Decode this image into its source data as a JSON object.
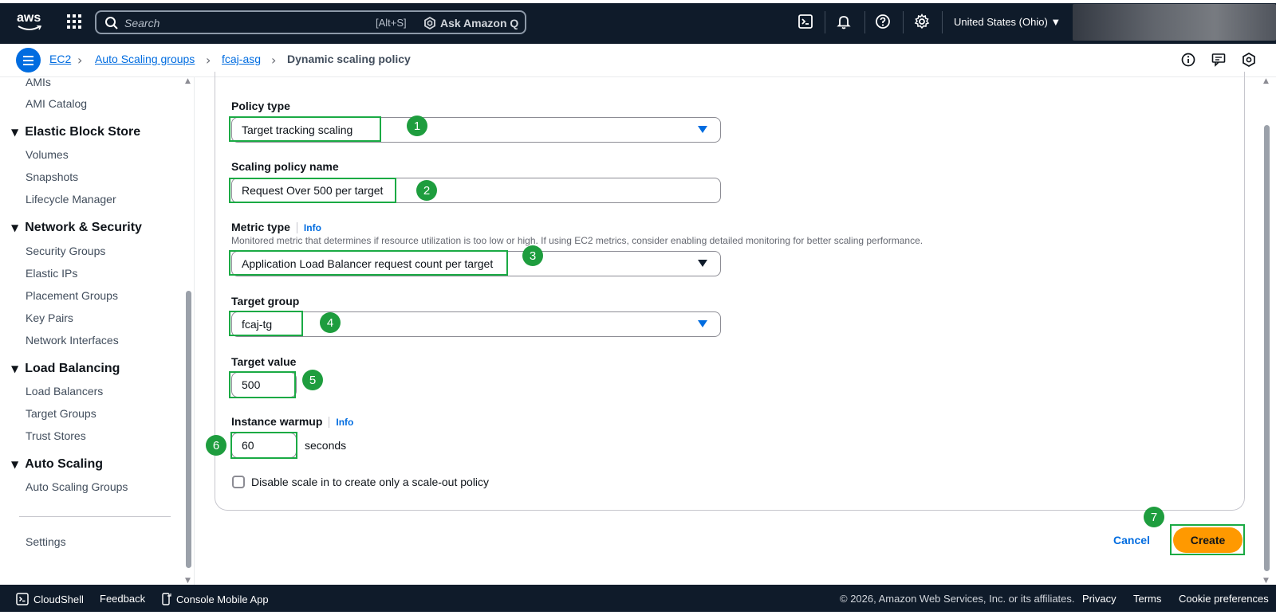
{
  "nav": {
    "logo_text": "aws",
    "search_placeholder": "Search",
    "search_shortcut": "[Alt+S]",
    "ask_q": "Ask Amazon Q",
    "region": "United States (Ohio) ▼",
    "icons": [
      "cloudshell-icon",
      "bell-icon",
      "help-icon",
      "gear-icon"
    ]
  },
  "breadcrumb": {
    "items": [
      "EC2",
      "Auto Scaling groups",
      "fcaj-asg"
    ],
    "current": "Dynamic scaling policy"
  },
  "sidebar": {
    "items_top": [
      "AMIs",
      "AMI Catalog"
    ],
    "sections": [
      {
        "title": "Elastic Block Store",
        "items": [
          "Volumes",
          "Snapshots",
          "Lifecycle Manager"
        ]
      },
      {
        "title": "Network & Security",
        "items": [
          "Security Groups",
          "Elastic IPs",
          "Placement Groups",
          "Key Pairs",
          "Network Interfaces"
        ]
      },
      {
        "title": "Load Balancing",
        "items": [
          "Load Balancers",
          "Target Groups",
          "Trust Stores"
        ]
      },
      {
        "title": "Auto Scaling",
        "items": [
          "Auto Scaling Groups"
        ]
      }
    ],
    "settings": "Settings"
  },
  "form": {
    "policy_type": {
      "label": "Policy type",
      "value": "Target tracking scaling"
    },
    "policy_name": {
      "label": "Scaling policy name",
      "value": "Request Over 500 per target"
    },
    "metric_type": {
      "label": "Metric type",
      "info": "Info",
      "description": "Monitored metric that determines if resource utilization is too low or high. If using EC2 metrics, consider enabling detailed monitoring for better scaling performance.",
      "value": "Application Load Balancer request count per target"
    },
    "target_group": {
      "label": "Target group",
      "value": "fcaj-tg"
    },
    "target_value": {
      "label": "Target value",
      "value": "500"
    },
    "warmup": {
      "label": "Instance warmup",
      "info": "Info",
      "value": "60",
      "unit": "seconds"
    },
    "disable_scale_in": {
      "label": "Disable scale in to create only a scale-out policy",
      "checked": false
    },
    "cancel": "Cancel",
    "create": "Create"
  },
  "annotations": [
    "1",
    "2",
    "3",
    "4",
    "5",
    "6",
    "7"
  ],
  "footer": {
    "cloudshell": "CloudShell",
    "feedback": "Feedback",
    "mobile_app": "Console Mobile App",
    "copyright": "© 2026, Amazon Web Services, Inc. or its affiliates.",
    "privacy": "Privacy",
    "terms": "Terms",
    "cookies": "Cookie preferences"
  },
  "colors": {
    "nav_bg": "#0f1b2a",
    "link": "#006ce0",
    "primary_button": "#ff9900",
    "highlight": "#1aaa44"
  }
}
